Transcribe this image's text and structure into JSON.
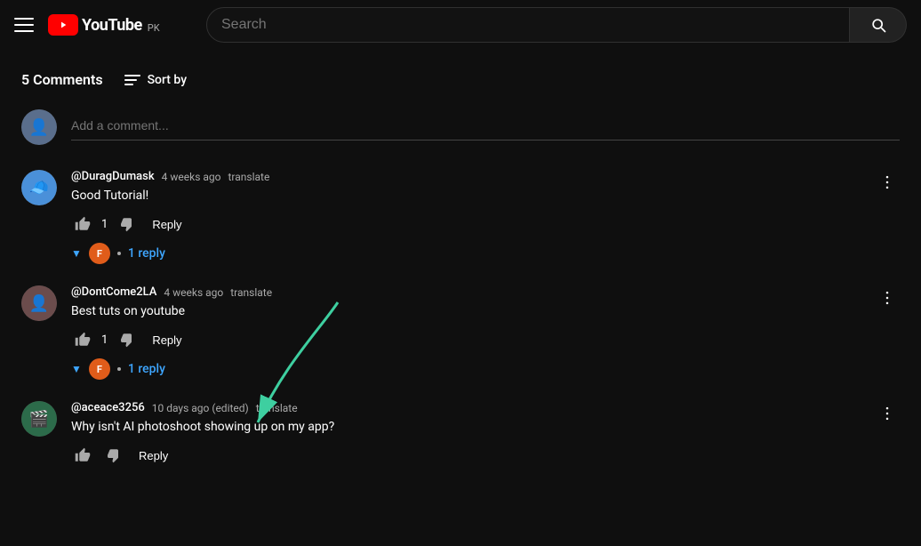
{
  "header": {
    "search_placeholder": "Search",
    "logo_text": "YouTube",
    "logo_country": "PK"
  },
  "comments": {
    "count_label": "5 Comments",
    "sort_by_label": "Sort by",
    "add_comment_placeholder": "Add a comment...",
    "items": [
      {
        "id": "comment-1",
        "author": "@DuragDumask",
        "time": "4 weeks ago",
        "translate": "translate",
        "text": "Good Tutorial!",
        "likes": "1",
        "replies_count": "1 reply",
        "avatar_emoji": "🧢",
        "avatar_bg": "#4a90d9"
      },
      {
        "id": "comment-2",
        "author": "@DontCome2LA",
        "time": "4 weeks ago",
        "translate": "translate",
        "text": "Best tuts on youtube",
        "likes": "1",
        "replies_count": "1 reply",
        "avatar_emoji": "👤",
        "avatar_bg": "#6b4c4c"
      },
      {
        "id": "comment-3",
        "author": "@aceace3256",
        "time": "10 days ago (edited)",
        "translate": "translate",
        "text": "Why isn't AI photoshoot showing up on my app?",
        "likes": "",
        "replies_count": "",
        "avatar_emoji": "🎬",
        "avatar_bg": "#2c6b4a"
      }
    ],
    "reply_label": "Reply",
    "filmorago_badge_text": "F"
  }
}
